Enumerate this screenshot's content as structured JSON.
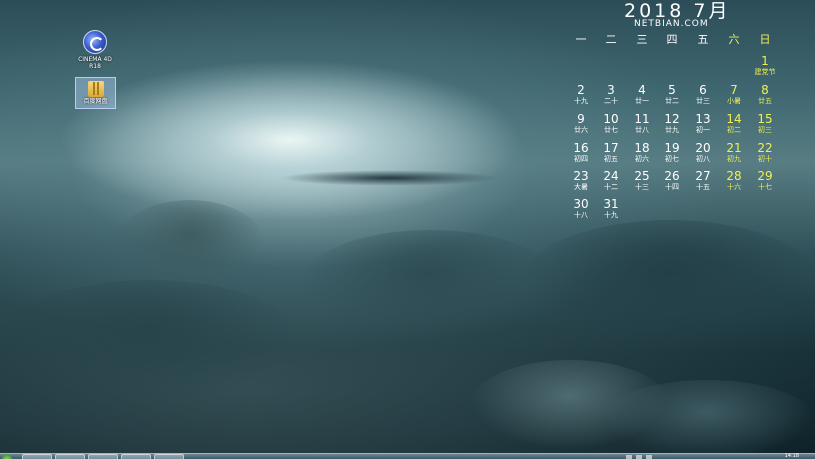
{
  "desktop": {
    "icons": [
      {
        "name": "cinema4d",
        "label_line1": "CINEMA 4D",
        "label_line2": "R18"
      },
      {
        "name": "folder",
        "label_line1": "百度网盘"
      }
    ]
  },
  "calendar": {
    "title": "2018 7月",
    "subtitle": "NETBIAN.COM",
    "weekdays": [
      "一",
      "二",
      "三",
      "四",
      "五",
      "六",
      "日"
    ],
    "days": [
      {
        "n": "1",
        "s": "建党节"
      },
      {
        "n": "2",
        "s": "十九"
      },
      {
        "n": "3",
        "s": "二十"
      },
      {
        "n": "4",
        "s": "廿一"
      },
      {
        "n": "5",
        "s": "廿二"
      },
      {
        "n": "6",
        "s": "廿三"
      },
      {
        "n": "7",
        "s": "小暑"
      },
      {
        "n": "8",
        "s": "廿五"
      },
      {
        "n": "9",
        "s": "廿六"
      },
      {
        "n": "10",
        "s": "廿七"
      },
      {
        "n": "11",
        "s": "廿八"
      },
      {
        "n": "12",
        "s": "廿九"
      },
      {
        "n": "13",
        "s": "初一"
      },
      {
        "n": "14",
        "s": "初二"
      },
      {
        "n": "15",
        "s": "初三"
      },
      {
        "n": "16",
        "s": "初四"
      },
      {
        "n": "17",
        "s": "初五"
      },
      {
        "n": "18",
        "s": "初六"
      },
      {
        "n": "19",
        "s": "初七"
      },
      {
        "n": "20",
        "s": "初八"
      },
      {
        "n": "21",
        "s": "初九"
      },
      {
        "n": "22",
        "s": "初十"
      },
      {
        "n": "23",
        "s": "大暑"
      },
      {
        "n": "24",
        "s": "十二"
      },
      {
        "n": "25",
        "s": "十三"
      },
      {
        "n": "26",
        "s": "十四"
      },
      {
        "n": "27",
        "s": "十五"
      },
      {
        "n": "28",
        "s": "十六"
      },
      {
        "n": "29",
        "s": "十七"
      },
      {
        "n": "30",
        "s": "十八"
      },
      {
        "n": "31",
        "s": "十九"
      }
    ],
    "weekend_color": "#f0f055"
  },
  "taskbar": {
    "clock": "14:18"
  }
}
